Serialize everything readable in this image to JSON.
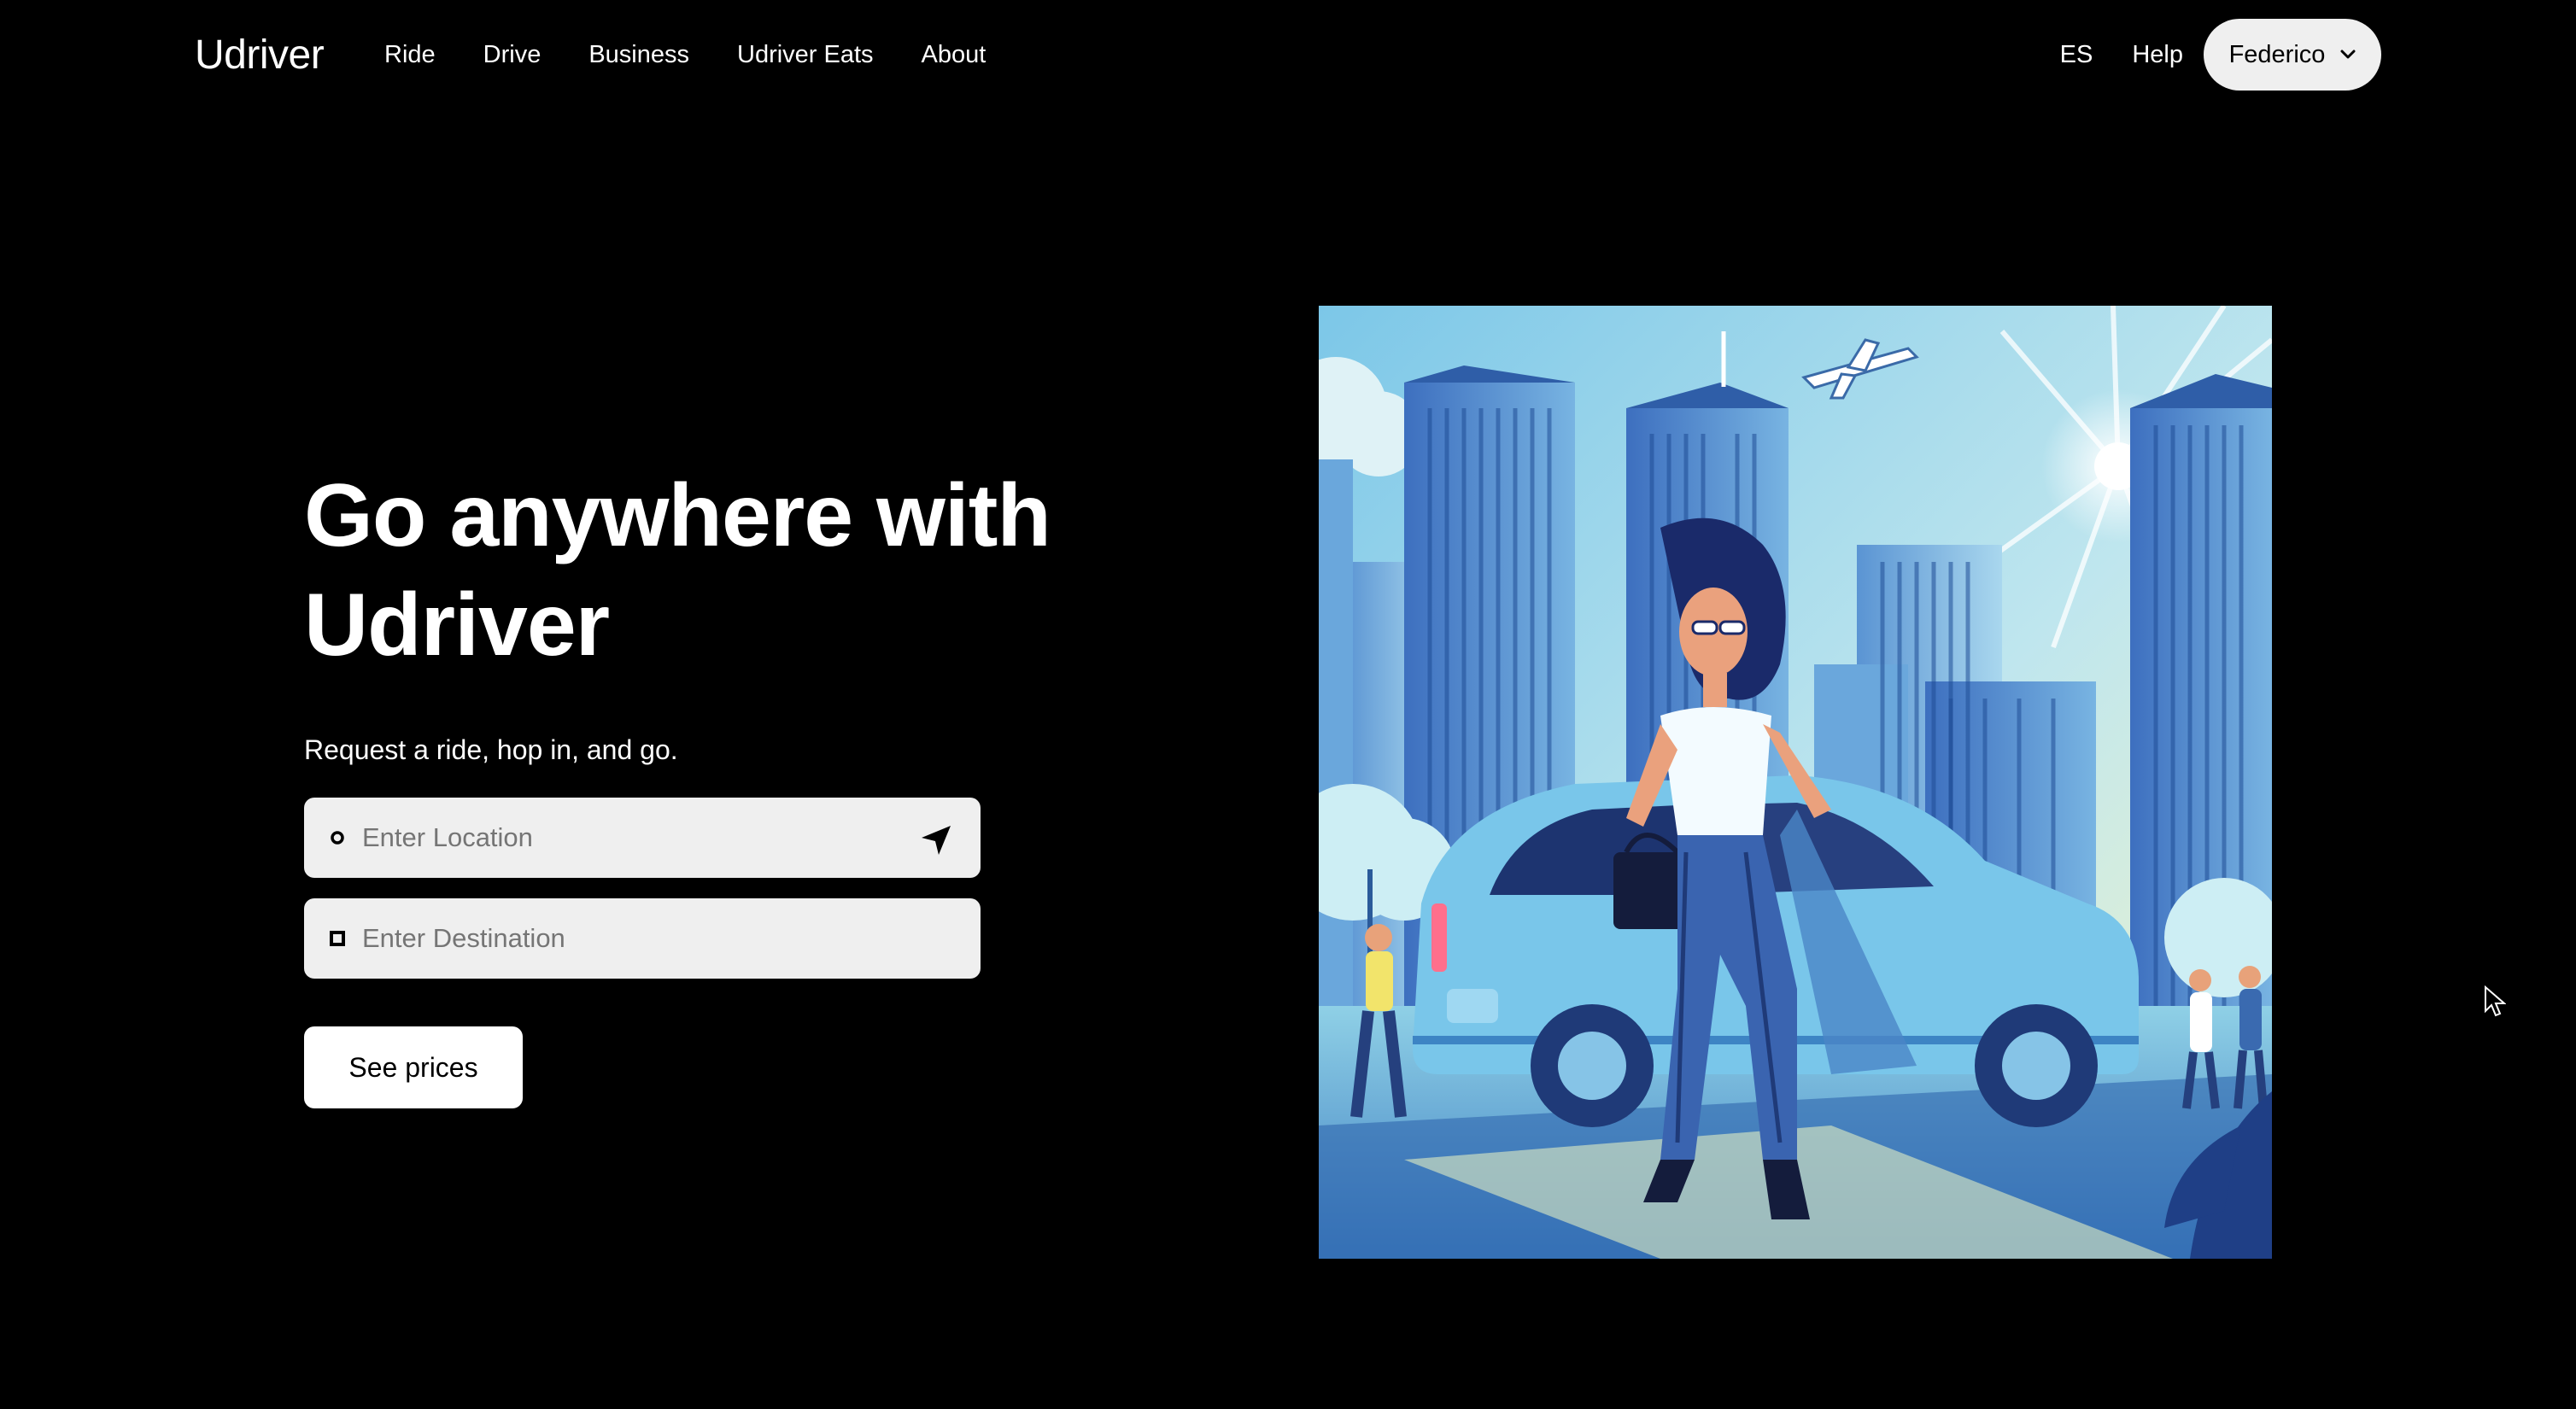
{
  "brand": {
    "name": "Udriver"
  },
  "nav": {
    "links": [
      {
        "label": "Ride"
      },
      {
        "label": "Drive"
      },
      {
        "label": "Business"
      },
      {
        "label": "Udriver Eats"
      },
      {
        "label": "About"
      }
    ],
    "language": "ES",
    "help": "Help",
    "user": {
      "name": "Federico",
      "icon": "chevron-down-icon"
    }
  },
  "hero": {
    "title": "Go anywhere with Udriver",
    "subtitle": "Request a ride, hop in, and go.",
    "location_field": {
      "placeholder": "Enter Location",
      "value": "",
      "icon": "location-arrow-icon"
    },
    "destination_field": {
      "placeholder": "Enter Destination",
      "value": ""
    },
    "cta_label": "See prices",
    "illustration": "woman-with-car-city-illustration"
  },
  "colors": {
    "background": "#000000",
    "text": "#ffffff",
    "field_bg": "#efefef",
    "placeholder": "#757575",
    "button_bg": "#ffffff"
  }
}
